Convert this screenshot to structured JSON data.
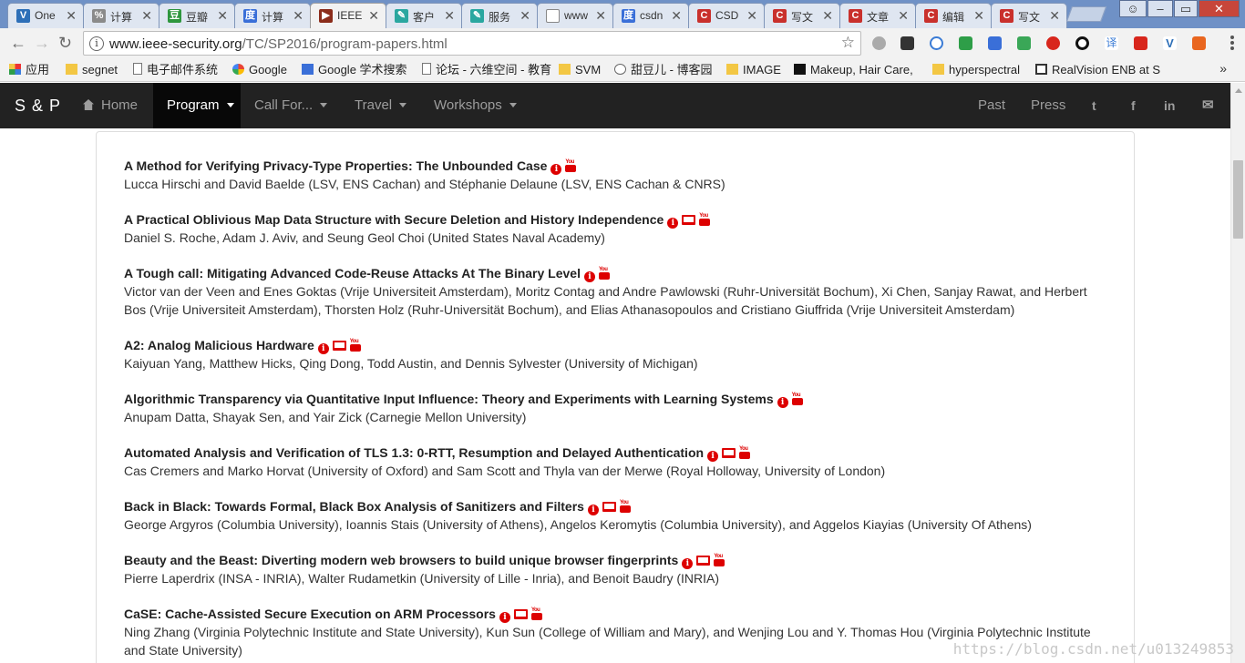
{
  "tabs": [
    {
      "title": "One",
      "favicon": "V",
      "color": "#2d6fb8"
    },
    {
      "title": "计算",
      "favicon": "%",
      "color": "#8a8a8a"
    },
    {
      "title": "豆瓣",
      "favicon": "豆",
      "color": "#2e963d"
    },
    {
      "title": "计算",
      "favicon": "度",
      "color": "#3a6fd8"
    },
    {
      "title": "IEEE",
      "favicon": "▶",
      "color": "#8b2c1a",
      "active": true
    },
    {
      "title": "客户",
      "favicon": "✎",
      "color": "#2aa7a0"
    },
    {
      "title": "服务",
      "favicon": "✎",
      "color": "#2aa7a0"
    },
    {
      "title": "www",
      "favicon": "",
      "color": "#ffffff"
    },
    {
      "title": "csdn",
      "favicon": "度",
      "color": "#3a6fd8"
    },
    {
      "title": "CSD",
      "favicon": "C",
      "color": "#c9302c"
    },
    {
      "title": "写文",
      "favicon": "C",
      "color": "#c9302c"
    },
    {
      "title": "文章",
      "favicon": "C",
      "color": "#c9302c"
    },
    {
      "title": "编辑",
      "favicon": "C",
      "color": "#c9302c"
    },
    {
      "title": "写文",
      "favicon": "C",
      "color": "#c9302c"
    }
  ],
  "address": {
    "host": "www.ieee-security.org",
    "path": "/TC/SP2016/program-papers.html"
  },
  "bookmarks": [
    {
      "label": "应用",
      "icon": "apps"
    },
    {
      "label": "segnet",
      "icon": "folder"
    },
    {
      "label": "电子邮件系统",
      "icon": "page"
    },
    {
      "label": "Google",
      "icon": "google"
    },
    {
      "label": "Google 学术搜索",
      "icon": "scholar"
    },
    {
      "label": "论坛 - 六维空间 - 教育",
      "icon": "page"
    },
    {
      "label": "SVM",
      "icon": "folder"
    },
    {
      "label": "甜豆儿 - 博客园",
      "icon": "blog"
    },
    {
      "label": "IMAGE",
      "icon": "folder"
    },
    {
      "label": "Makeup, Hair Care,",
      "icon": "makeup"
    },
    {
      "label": "hyperspectral",
      "icon": "folder"
    },
    {
      "label": "RealVision ENB at S",
      "icon": "x"
    }
  ],
  "bookmarks_more": "»",
  "site": {
    "brand": "S & P",
    "nav": {
      "home": "Home",
      "program": "Program",
      "call_for": "Call For...",
      "travel": "Travel",
      "workshops": "Workshops",
      "past": "Past",
      "press": "Press"
    },
    "social": {
      "twitter": "t",
      "facebook": "f",
      "linkedin": "in",
      "email": "✉"
    }
  },
  "papers": [
    {
      "title": "A Method for Verifying Privacy-Type Properties: The Unbounded Case",
      "icons": [
        "info",
        "video"
      ],
      "authors": [
        "Lucca Hirschi and David Baelde (LSV, ENS Cachan) and Stéphanie Delaune (LSV, ENS Cachan & CNRS)"
      ]
    },
    {
      "title": "A Practical Oblivious Map Data Structure with Secure Deletion and History Independence",
      "icons": [
        "info",
        "slides",
        "video"
      ],
      "authors": [
        "Daniel S. Roche, Adam J. Aviv, and Seung Geol Choi (United States Naval Academy)"
      ]
    },
    {
      "title": "A Tough call: Mitigating Advanced Code-Reuse Attacks At The Binary Level",
      "icons": [
        "info",
        "video"
      ],
      "authors": [
        "Victor van der Veen and Enes Goktas (Vrije Universiteit Amsterdam), Moritz Contag and Andre Pawlowski (Ruhr-Universität Bochum), Xi Chen, Sanjay Rawat, and Herbert",
        "Bos (Vrije Universiteit Amsterdam), Thorsten Holz (Ruhr-Universität Bochum), and Elias Athanasopoulos and Cristiano Giuffrida (Vrije Universiteit Amsterdam)"
      ]
    },
    {
      "title": "A2: Analog Malicious Hardware",
      "icons": [
        "info",
        "slides",
        "video"
      ],
      "authors": [
        "Kaiyuan Yang, Matthew Hicks, Qing Dong, Todd Austin, and Dennis Sylvester (University of Michigan)"
      ]
    },
    {
      "title": "Algorithmic Transparency via Quantitative Input Influence: Theory and Experiments with Learning Systems",
      "icons": [
        "info",
        "video"
      ],
      "authors": [
        "Anupam Datta, Shayak Sen, and Yair Zick (Carnegie Mellon University)"
      ]
    },
    {
      "title": "Automated Analysis and Verification of TLS 1.3: 0-RTT, Resumption and Delayed Authentication",
      "icons": [
        "info",
        "slides",
        "video"
      ],
      "authors": [
        "Cas Cremers and Marko Horvat (University of Oxford) and Sam Scott and Thyla van der Merwe (Royal Holloway, University of London)"
      ]
    },
    {
      "title": "Back in Black: Towards Formal, Black Box Analysis of Sanitizers and Filters",
      "icons": [
        "info",
        "slides",
        "video"
      ],
      "authors": [
        "George Argyros (Columbia University), Ioannis Stais (University of Athens), Angelos Keromytis (Columbia University), and Aggelos Kiayias (University Of Athens)"
      ]
    },
    {
      "title": "Beauty and the Beast: Diverting modern web browsers to build unique browser fingerprints",
      "icons": [
        "info",
        "slides",
        "video"
      ],
      "authors": [
        "Pierre Laperdrix (INSA - INRIA), Walter Rudametkin (University of Lille - Inria), and Benoit Baudry (INRIA)"
      ]
    },
    {
      "title": "CaSE: Cache-Assisted Secure Execution on ARM Processors",
      "icons": [
        "info",
        "slides",
        "video"
      ],
      "authors": [
        "Ning Zhang (Virginia Polytechnic Institute and State University), Kun Sun (College of William and Mary), and Wenjing Lou and Y. Thomas Hou (Virginia Polytechnic Institute",
        "and State University)"
      ]
    }
  ],
  "watermark": "https://blog.csdn.net/u013249853",
  "colors": {
    "accent_red": "#dd0000",
    "navbar": "#222222"
  }
}
